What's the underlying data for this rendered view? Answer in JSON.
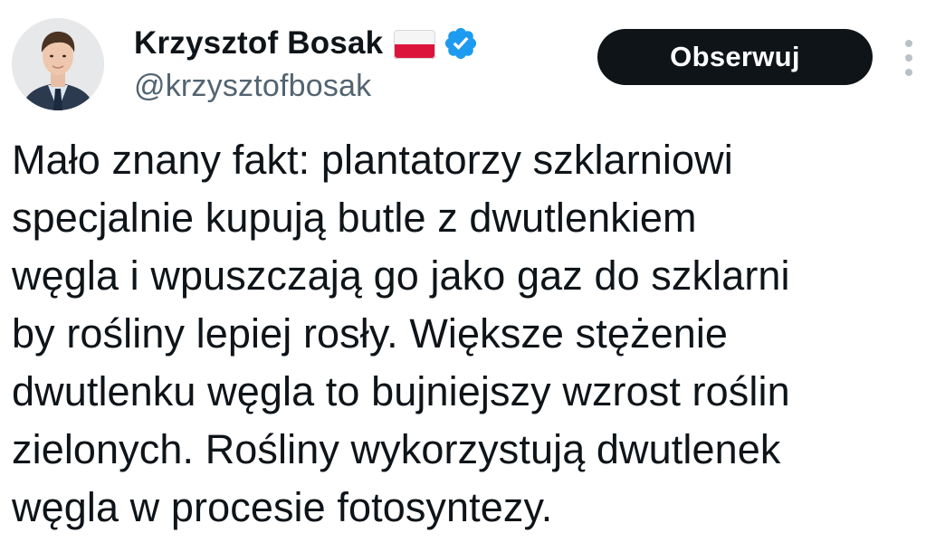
{
  "author": {
    "display_name": "Krzysztof Bosak",
    "handle": "@krzysztofbosak",
    "flag_icon": "poland-flag-icon",
    "verified_icon": "verified-badge-icon",
    "verified_color": "#1d9bf0"
  },
  "actions": {
    "follow_label": "Obserwuj",
    "more_icon": "more-vertical-icon"
  },
  "tweet": {
    "lines": [
      "Mało znany fakt: plantatorzy szklarniowi",
      "specjalnie kupują butle z dwutlenkiem",
      "węgla i wpuszczają go jako gaz do szklarni",
      "by rośliny lepiej rosły. Większe stężenie",
      "dwutlenku węgla to bujniejszy wzrost roślin",
      "zielonych. Rośliny wykorzystują dwutlenek",
      "węgla w procesie fotosyntezy."
    ]
  },
  "colors": {
    "text": "#0f1419",
    "secondary_text": "#536471",
    "button_bg": "#0f1419",
    "button_text": "#ffffff",
    "flag_white": "#f5f5f5",
    "flag_red": "#dc143c"
  }
}
